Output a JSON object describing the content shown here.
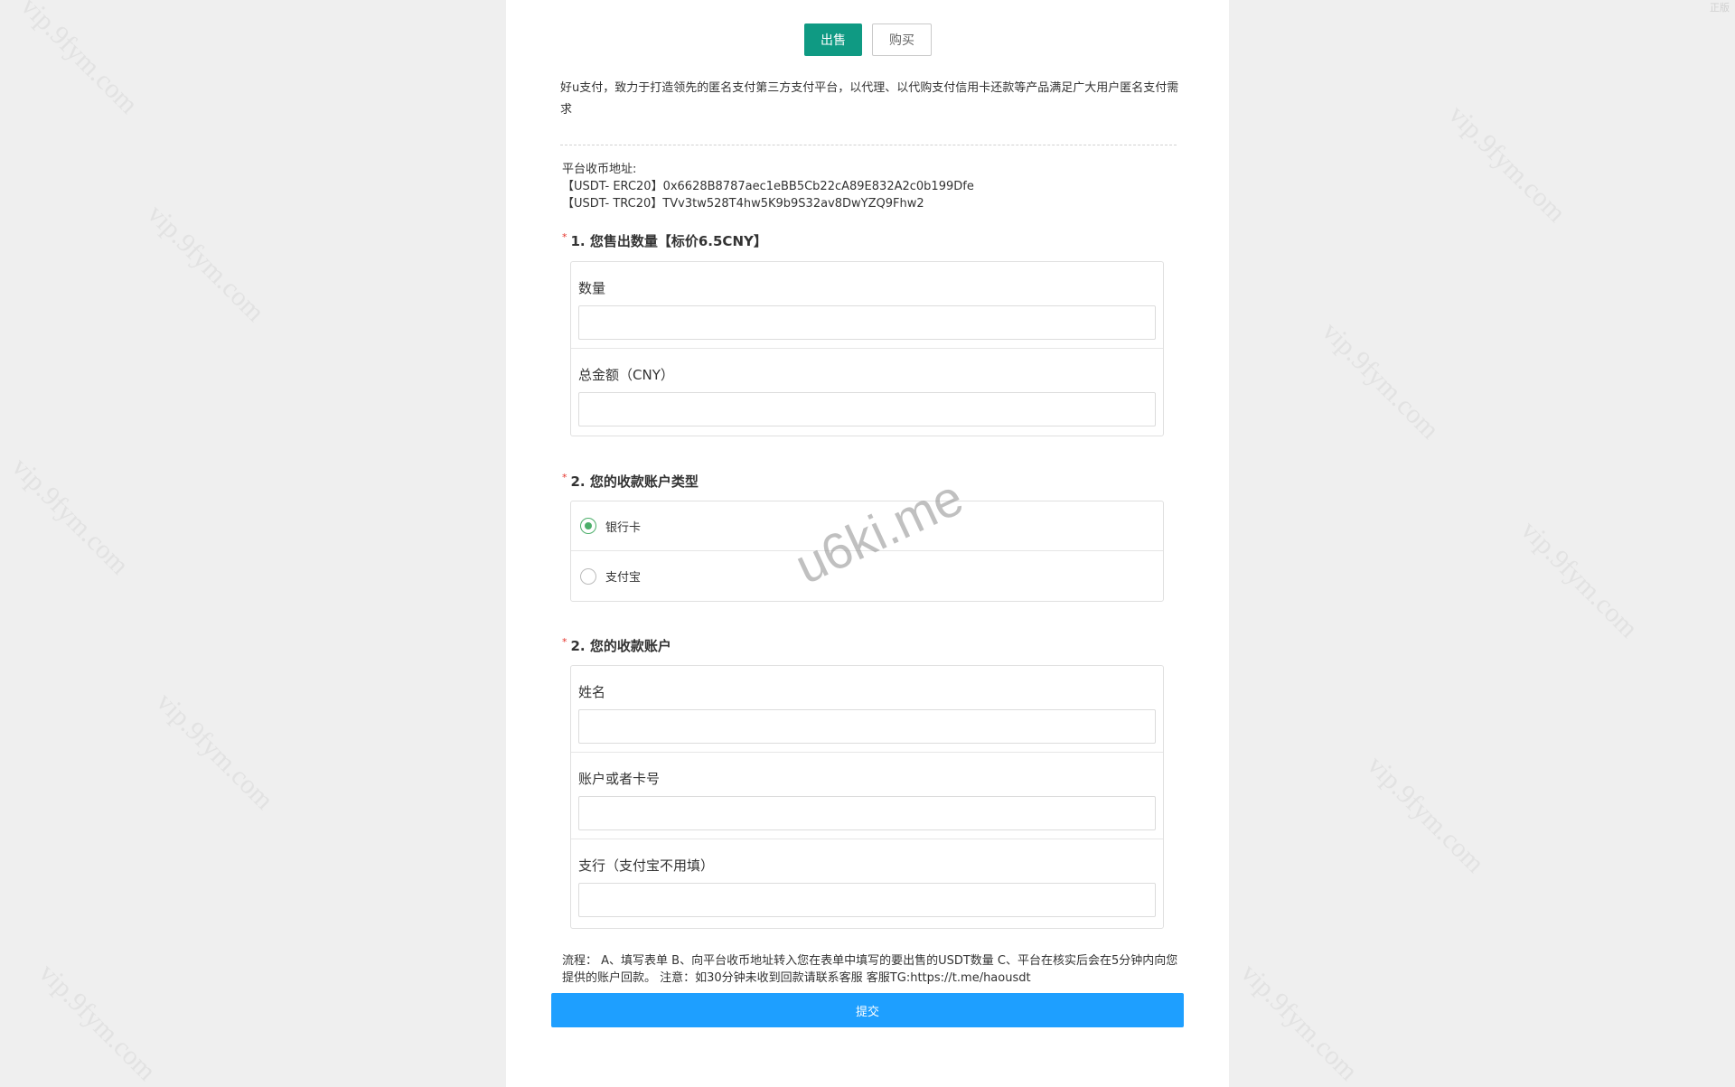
{
  "tabs": {
    "sell": "出售",
    "buy": "购买"
  },
  "intro": "好u支付，致力于打造领先的匿名支付第三方支付平台，以代理、以代购支付信用卡还款等产品满足广大用户匿名支付需求",
  "address": {
    "title": "平台收币地址:",
    "erc20": "【USDT- ERC20】0x6628B8787aec1eBB5Cb22cA89E832A2c0b199Dfe",
    "trc20": "【USDT- TRC20】TVv3tw528T4hw5K9b9S32av8DwYZQ9Fhw2"
  },
  "section1": {
    "required_mark": "*",
    "title": "1. 您售出数量【标价6.5CNY】",
    "quantity_label": "数量",
    "quantity_value": "",
    "total_label": "总金额（CNY）",
    "total_value": ""
  },
  "section2": {
    "required_mark": "*",
    "title": "2. 您的收款账户类型",
    "options": [
      {
        "label": "银行卡",
        "checked": true
      },
      {
        "label": "支付宝",
        "checked": false
      }
    ]
  },
  "section3": {
    "required_mark": "*",
    "title": "2. 您的收款账户",
    "name_label": "姓名",
    "name_value": "",
    "account_label": "账户或者卡号",
    "account_value": "",
    "branch_label": "支行（支付宝不用填）",
    "branch_value": ""
  },
  "process_note": "流程： A、填写表单 B、向平台收币地址转入您在表单中填写的要出售的USDT数量 C、平台在核实后会在5分钟内向您提供的账户回款。 注意：如30分钟未收到回款请联系客服 客服TG:https://t.me/haousdt",
  "submit_label": "提交",
  "watermarks": {
    "overlay": "u6ki.me",
    "tile": "vip.9fym.com",
    "corner": "正版"
  },
  "colors": {
    "sell_tab": "#0f9a83",
    "submit": "#1e9fff",
    "radio_checked": "#4cae6a",
    "required": "#e5332a"
  }
}
